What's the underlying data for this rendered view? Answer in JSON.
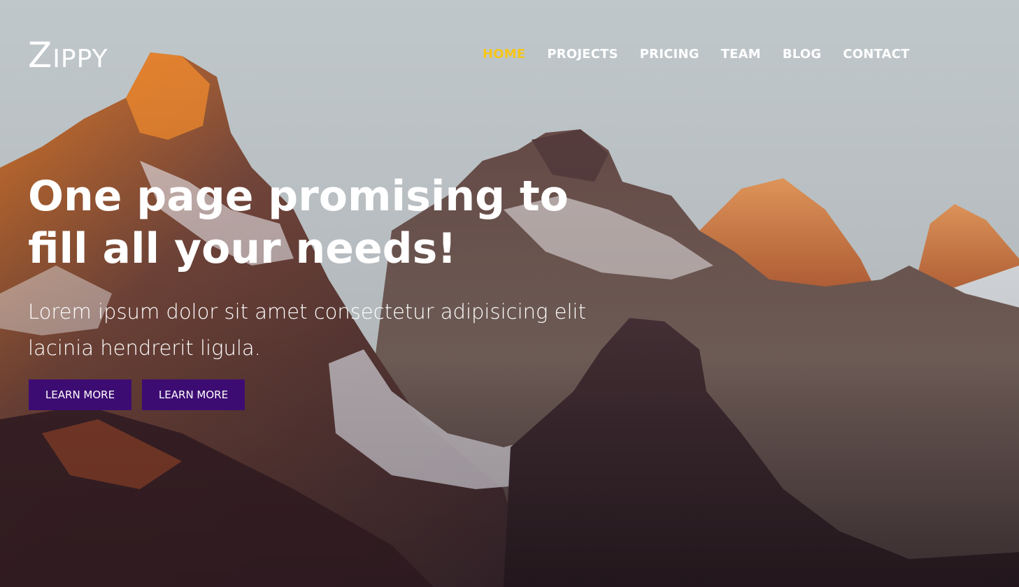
{
  "brand": {
    "logo_first": "Z",
    "logo_rest": "IPPY"
  },
  "nav": {
    "items": [
      {
        "label": "HOME",
        "active": true
      },
      {
        "label": "PROJECTS"
      },
      {
        "label": "PRICING"
      },
      {
        "label": "TEAM"
      },
      {
        "label": "BLOG"
      },
      {
        "label": "CONTACT"
      }
    ]
  },
  "hero": {
    "headline_line1": "One page promising to",
    "headline_line2": "fill all your needs!",
    "subtitle": "Lorem ipsum dolor sit amet consectetur adipisicing elit lacinia hendrerit ligula.",
    "buttons": [
      {
        "label": "LEARN MORE"
      },
      {
        "label": "LEARN MORE"
      }
    ]
  },
  "colors": {
    "accent": "#f5c518",
    "button": "#3d0c73",
    "text": "#ffffff"
  }
}
